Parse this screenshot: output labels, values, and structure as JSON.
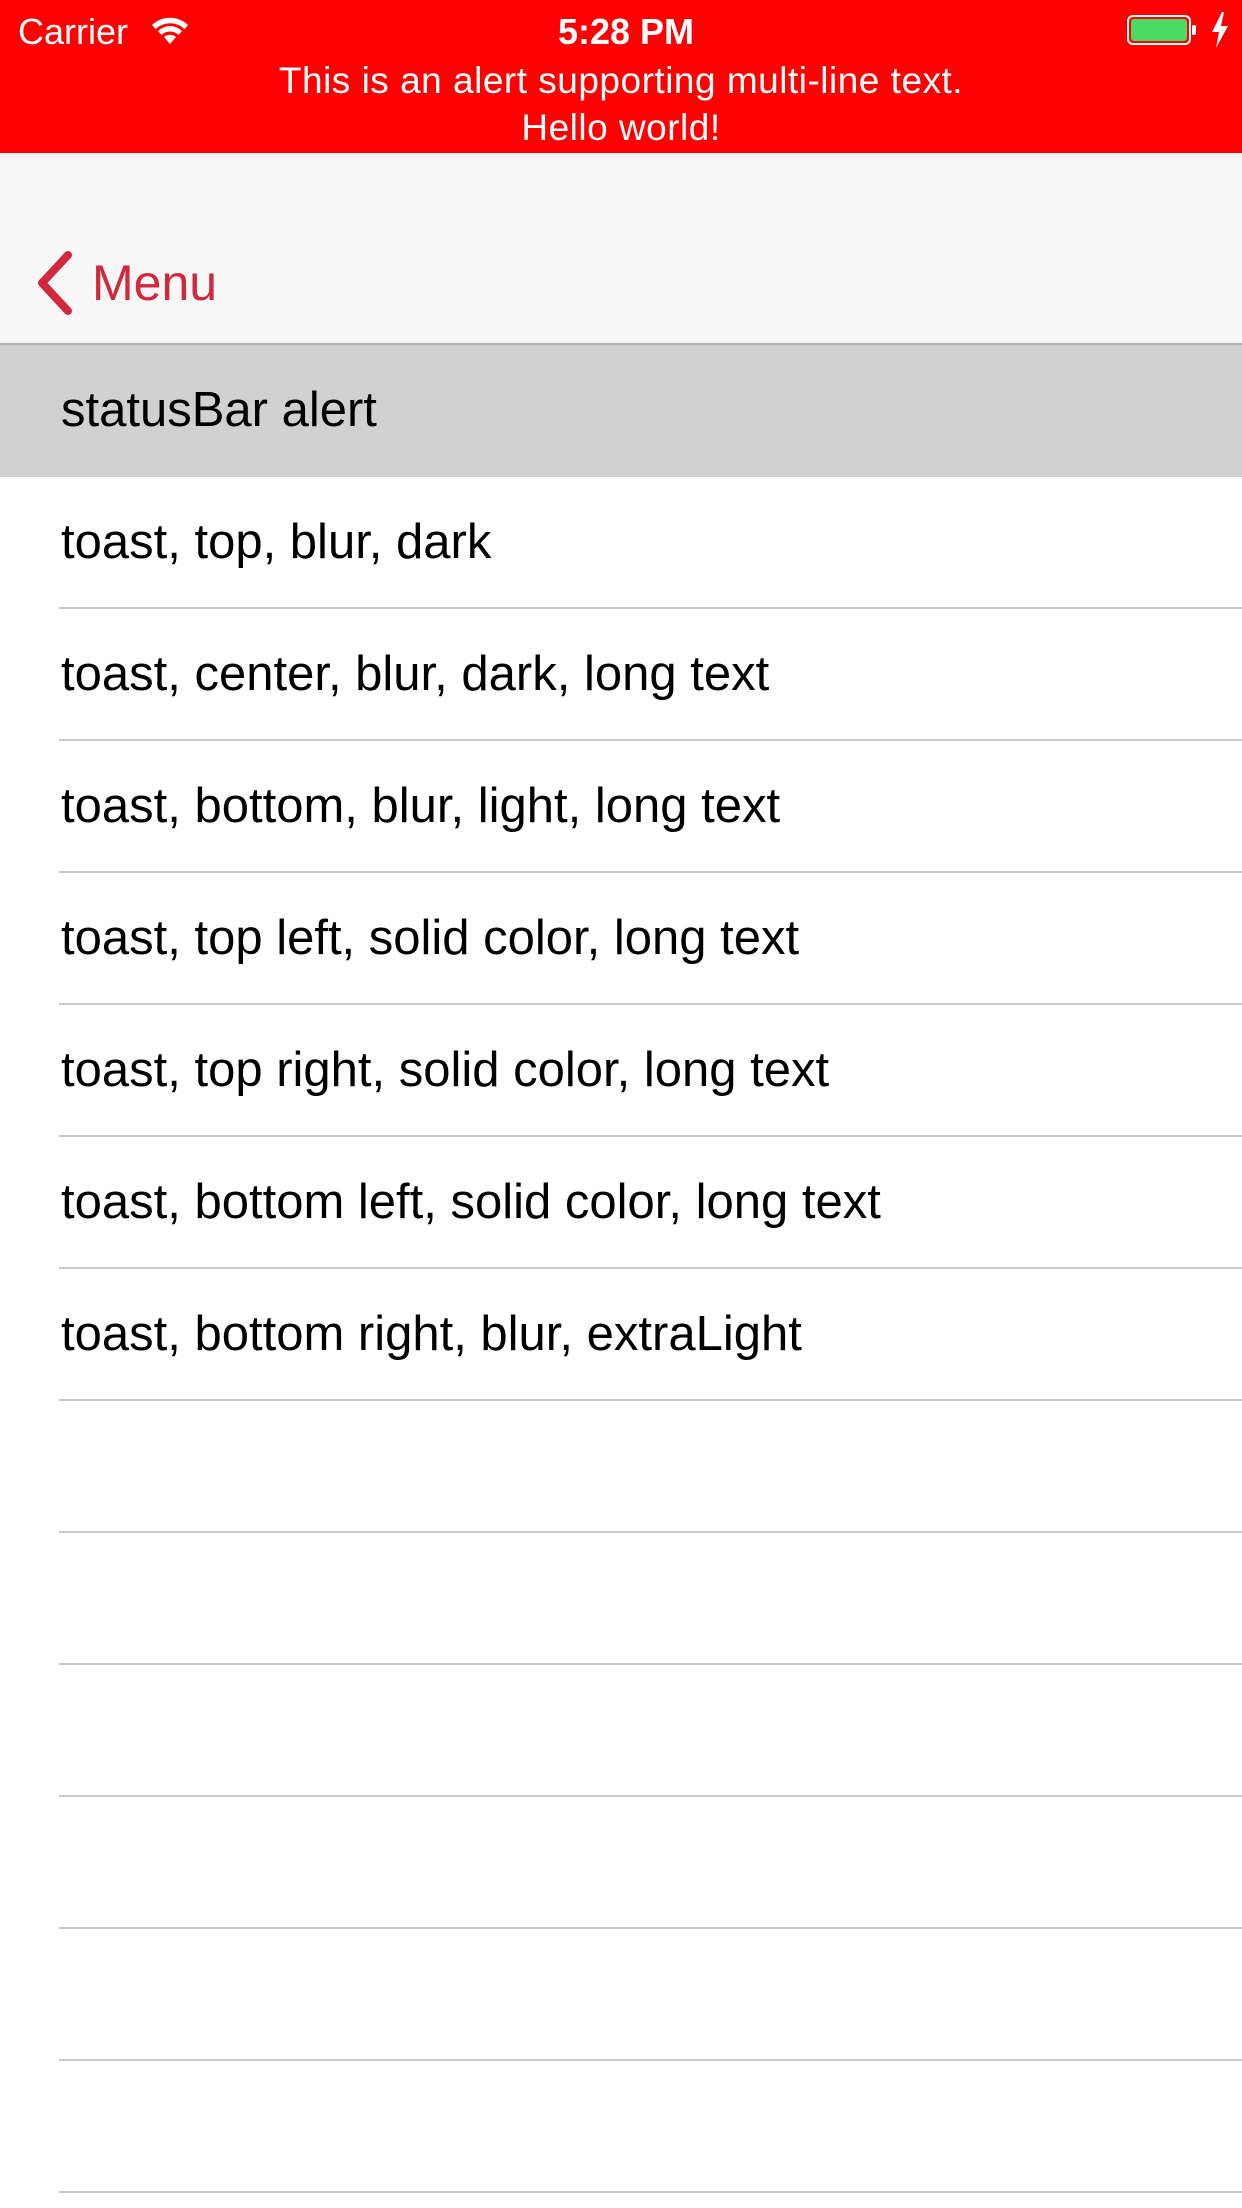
{
  "status_bar": {
    "carrier": "Carrier",
    "time": "5:28 PM",
    "wifi_icon": "wifi-icon",
    "battery_icon": "battery-icon",
    "charging_icon": "charging-bolt-icon",
    "battery_level": 1.0
  },
  "alert": {
    "line1": "This is an alert supporting multi-line text.",
    "line2": "Hello world!",
    "background_color": "#ff0000",
    "text_color": "#ffffff"
  },
  "nav": {
    "back_label": "Menu",
    "back_icon": "chevron-left-icon",
    "tint_color": "#d0283c"
  },
  "table": {
    "rows": [
      {
        "label": "statusBar alert",
        "selected": true
      },
      {
        "label": "toast, top, blur, dark",
        "selected": false
      },
      {
        "label": "toast, center, blur, dark, long text",
        "selected": false
      },
      {
        "label": "toast, bottom, blur, light, long text",
        "selected": false
      },
      {
        "label": "toast, top left, solid color, long text",
        "selected": false
      },
      {
        "label": "toast, top right, solid color, long text",
        "selected": false
      },
      {
        "label": "toast, bottom left, solid color, long text",
        "selected": false
      },
      {
        "label": "toast, bottom right, blur, extraLight",
        "selected": false
      },
      {
        "label": "",
        "selected": false
      },
      {
        "label": "",
        "selected": false
      },
      {
        "label": "",
        "selected": false
      },
      {
        "label": "",
        "selected": false
      },
      {
        "label": "",
        "selected": false
      },
      {
        "label": "",
        "selected": false
      }
    ]
  }
}
